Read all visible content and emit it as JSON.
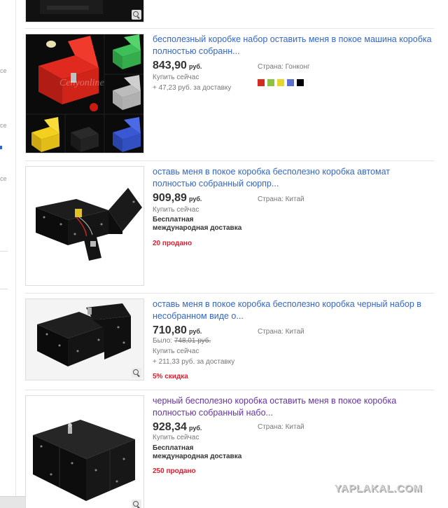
{
  "sidebar": {
    "fragments": [
      "ce",
      "ce",
      "ce"
    ]
  },
  "listings": [
    {
      "title": "",
      "partial_top": true
    },
    {
      "title": "бесполезный коробке набор оставить меня в покое машина коробка полностью собранн...",
      "price": "843,90",
      "currency": "руб.",
      "buy_now": "Купить сейчас",
      "shipping": "+ 47,23 руб. за доставку",
      "country": "Страна: Гонконг",
      "image_watermark": "Cenyonline",
      "colors": [
        "#d62b20",
        "#8bc43f",
        "#e8d52a",
        "#5a6fd0",
        "#000000"
      ]
    },
    {
      "title": "оставь меня в покое коробка бесполезно коробка автомат полностью собранный сюрпр...",
      "price": "909,89",
      "currency": "руб.",
      "buy_now": "Купить сейчас",
      "shipping_line1": "Бесплатная",
      "shipping_line2": "международная доставка",
      "sold": "20 продано",
      "country": "Страна: Китай"
    },
    {
      "title": "оставь меня в покое коробка бесполезно коробка черный набор в несобранном виде о...",
      "price": "710,80",
      "currency": "руб.",
      "was_label": "Было:",
      "was_price": "748,01 руб.",
      "buy_now": "Купить сейчас",
      "shipping": "+ 211,33 руб. за доставку",
      "discount": "5% скидка",
      "country": "Страна: Китай"
    },
    {
      "title": "черный бесполезно коробка оставить меня в покое коробка полностью собранный набо...",
      "price": "928,34",
      "currency": "руб.",
      "buy_now": "Купить сейчас",
      "shipping_line1": "Бесплатная",
      "shipping_line2": "международная доставка",
      "sold": "250 продано",
      "country": "Страна: Китай"
    }
  ],
  "watermark": "YAPLAKAL.COM"
}
